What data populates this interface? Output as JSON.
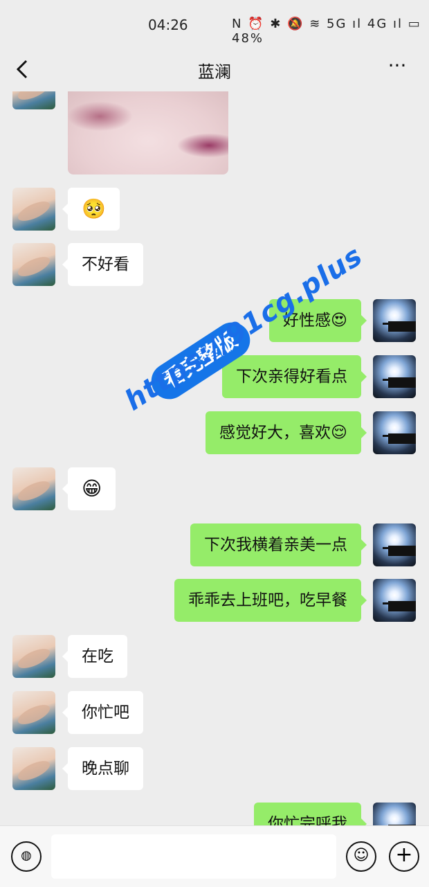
{
  "status_bar": {
    "time": "04:26",
    "battery": "48%",
    "icons": "N ⏰ ✱ 🔕 ≋ 5G ıl 4G ıl ▭"
  },
  "header": {
    "title": "蓝澜",
    "more": "···"
  },
  "messages": [
    {
      "side": "left",
      "type": "image"
    },
    {
      "side": "left",
      "text": "🥺"
    },
    {
      "side": "left",
      "text": "不好看"
    },
    {
      "side": "right",
      "text": "好性感😍"
    },
    {
      "side": "right",
      "text": "下次亲得好看点"
    },
    {
      "side": "right",
      "text": "感觉好大，喜欢😌"
    },
    {
      "side": "left",
      "text": "😁"
    },
    {
      "side": "right",
      "text": "下次我横着亲美一点"
    },
    {
      "side": "right",
      "text": "乖乖去上班吧，吃早餐"
    },
    {
      "side": "left",
      "text": "在吃"
    },
    {
      "side": "left",
      "text": "你忙吧"
    },
    {
      "side": "left",
      "text": "晚点聊"
    },
    {
      "side": "right",
      "text": "你忙完呼我"
    }
  ],
  "watermark": {
    "badge": "看完整版",
    "url": "https://91cg.plus"
  },
  "input_bar": {
    "voice_icon": "voice-icon",
    "emoji_icon": "emoji-icon",
    "plus_icon": "plus-icon"
  }
}
